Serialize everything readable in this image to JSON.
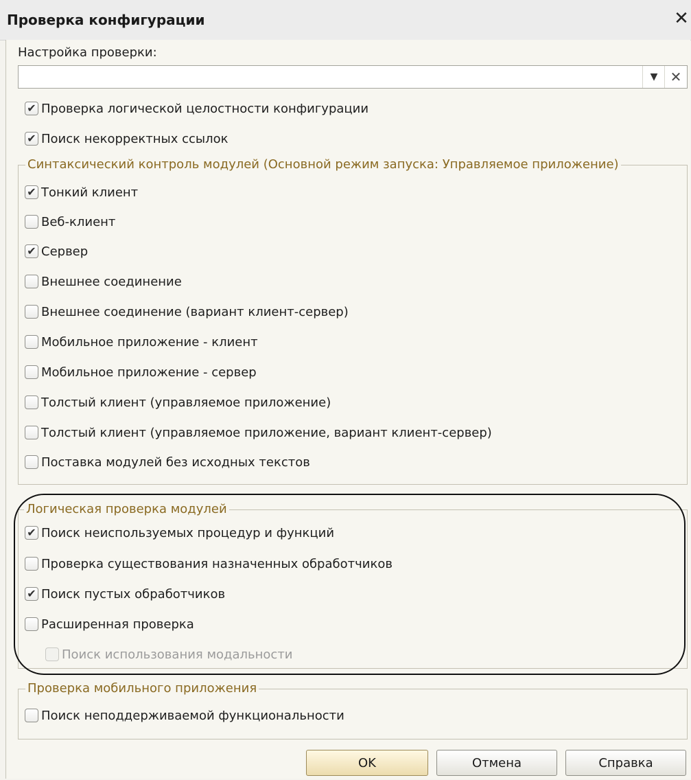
{
  "window": {
    "title": "Проверка конфигурации",
    "close_glyph": "✕"
  },
  "settings": {
    "label": "Настройка проверки:",
    "value": "",
    "placeholder": ""
  },
  "general_checks": [
    {
      "label": "Проверка логической целостности конфигурации",
      "checked": true
    },
    {
      "label": "Поиск некорректных ссылок",
      "checked": true
    }
  ],
  "syntax_group": {
    "title": "Синтаксический контроль модулей (Основной режим запуска: Управляемое приложение)",
    "items": [
      {
        "label": "Тонкий клиент",
        "checked": true
      },
      {
        "label": "Веб-клиент",
        "checked": false
      },
      {
        "label": "Сервер",
        "checked": true
      },
      {
        "label": "Внешнее соединение",
        "checked": false
      },
      {
        "label": "Внешнее соединение (вариант клиент-сервер)",
        "checked": false
      },
      {
        "label": "Мобильное приложение - клиент",
        "checked": false
      },
      {
        "label": "Мобильное приложение - сервер",
        "checked": false
      },
      {
        "label": "Толстый клиент (управляемое приложение)",
        "checked": false
      },
      {
        "label": "Толстый клиент (управляемое приложение, вариант клиент-сервер)",
        "checked": false
      },
      {
        "label": "Поставка модулей без исходных текстов",
        "checked": false
      }
    ]
  },
  "logic_group": {
    "title": "Логическая проверка модулей",
    "items": [
      {
        "label": "Поиск неиспользуемых процедур и функций",
        "checked": true
      },
      {
        "label": "Проверка существования назначенных обработчиков",
        "checked": false
      },
      {
        "label": "Поиск пустых обработчиков",
        "checked": true
      },
      {
        "label": "Расширенная проверка",
        "checked": false
      },
      {
        "label": "Поиск использования модальности",
        "checked": false,
        "disabled": true
      }
    ]
  },
  "mobile_group": {
    "title": "Проверка мобильного приложения",
    "items": [
      {
        "label": "Поиск неподдерживаемой функциональности",
        "checked": false
      }
    ]
  },
  "buttons": {
    "ok": "OK",
    "cancel": "Отмена",
    "help": "Справка"
  },
  "check_glyph": "✔",
  "icons": {
    "dropdown": "▼",
    "clear": "✕",
    "close": "✕"
  },
  "colors": {
    "group_title": "#8a6a22",
    "highlight_border": "#111111",
    "ok_button": "#ecdcae"
  }
}
